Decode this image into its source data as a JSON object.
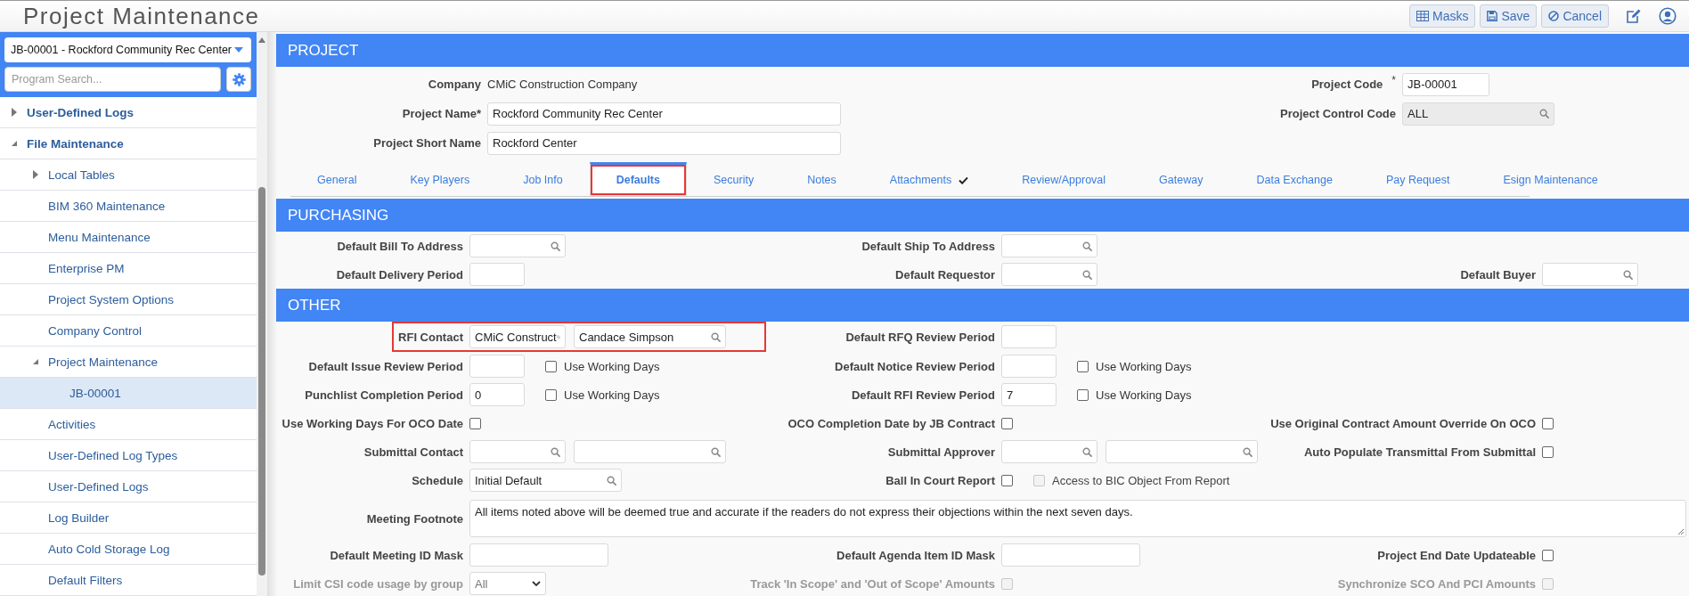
{
  "header": {
    "title": "Project Maintenance",
    "buttons": [
      {
        "kind": "masks",
        "label": "Masks"
      },
      {
        "kind": "save",
        "label": "Save"
      },
      {
        "kind": "cancel",
        "label": "Cancel"
      }
    ]
  },
  "sidebar": {
    "project_select": "JB-00001 - Rockford Community Rec Center",
    "search": {
      "placeholder": "Program Search..."
    },
    "items": [
      {
        "label": "User-Defined Logs",
        "expanded": false,
        "selected": false
      },
      {
        "label": "File Maintenance",
        "expanded": true,
        "selected": false,
        "children": [
          {
            "label": "Local Tables",
            "expanded": false,
            "selected": false
          },
          {
            "label": "BIM 360 Maintenance",
            "selected": false
          },
          {
            "label": "Menu Maintenance",
            "selected": false
          },
          {
            "label": "Enterprise PM",
            "selected": false
          },
          {
            "label": "Project System Options",
            "selected": false
          },
          {
            "label": "Company Control",
            "selected": false
          },
          {
            "label": "Project Maintenance",
            "expanded": true,
            "selected": false,
            "children": [
              {
                "label": "JB-00001",
                "selected": true
              }
            ]
          },
          {
            "label": "Activities",
            "selected": false
          },
          {
            "label": "User-Defined Log Types",
            "selected": false
          },
          {
            "label": "User-Defined Logs",
            "selected": false
          },
          {
            "label": "Log Builder",
            "selected": false
          },
          {
            "label": "Auto Cold Storage Log",
            "selected": false
          },
          {
            "label": "Default Filters",
            "selected": false
          }
        ]
      }
    ]
  },
  "project": {
    "title": "PROJECT",
    "rows": [
      {
        "left": {
          "label": "Company",
          "controls": [
            {
              "kind": "static",
              "value": "CMiC Construction Company"
            }
          ]
        },
        "right": {
          "label": "Project Code",
          "marker": "*",
          "controls": [
            {
              "kind": "code-text",
              "value": "JB-00001"
            }
          ]
        }
      },
      {
        "left": {
          "label": "Project Name*",
          "controls": [
            {
              "kind": "wide-text",
              "value": "Rockford Community Rec Center"
            }
          ]
        },
        "right": {
          "label": "Project Control Code",
          "controls": [
            {
              "kind": "wide-lookup",
              "value": "ALL",
              "disabled": true
            }
          ]
        }
      },
      {
        "left": {
          "label": "Project Short Name",
          "controls": [
            {
              "kind": "wide-text",
              "value": "Rockford Center"
            }
          ]
        }
      }
    ],
    "tabs": [
      {
        "label": "General",
        "selected": false
      },
      {
        "label": "Key Players",
        "selected": false
      },
      {
        "label": "Job Info",
        "selected": false
      },
      {
        "label": "Defaults",
        "selected": true,
        "highlighted": true
      },
      {
        "label": "Security",
        "selected": false
      },
      {
        "label": "Notes",
        "selected": false
      },
      {
        "label": "Attachments",
        "selected": false,
        "checked": true
      },
      {
        "label": "Review/Approval",
        "selected": false
      },
      {
        "label": "Gateway",
        "selected": false
      },
      {
        "label": "Data Exchange",
        "selected": false
      },
      {
        "label": "Pay Request",
        "selected": false
      },
      {
        "label": "Esign Maintenance",
        "selected": false
      }
    ]
  },
  "purchasing": {
    "title": "PURCHASING",
    "rows": [
      {
        "left": {
          "label": "Default Bill To Address",
          "controls": [
            {
              "kind": "lookup"
            }
          ]
        },
        "middle": {
          "label": "Default Ship To Address",
          "controls": [
            {
              "kind": "lookup"
            }
          ]
        }
      },
      {
        "left": {
          "label": "Default Delivery Period",
          "controls": [
            {
              "kind": "short-text"
            }
          ]
        },
        "middle": {
          "label": "Default Requestor",
          "controls": [
            {
              "kind": "lookup"
            }
          ]
        },
        "right": {
          "label": "Default Buyer",
          "controls": [
            {
              "kind": "lookup"
            }
          ]
        }
      }
    ]
  },
  "other": {
    "title": "OTHER",
    "rows": [
      {
        "left": {
          "label": "RFI Contact",
          "highlighted": true,
          "controls": [
            {
              "kind": "lookup",
              "value": "CMiC Construct"
            },
            {
              "kind": "wide-lookup",
              "value": "Candace Simpson"
            }
          ]
        },
        "middle": {
          "label": "Default RFQ Review Period",
          "controls": [
            {
              "kind": "short-text"
            }
          ]
        }
      },
      {
        "left": {
          "label": "Default Issue Review Period",
          "controls": [
            {
              "kind": "short-text"
            },
            {
              "kind": "checkbox",
              "label": "Use Working Days",
              "checked": false
            }
          ]
        },
        "middle": {
          "label": "Default Notice Review Period",
          "controls": [
            {
              "kind": "short-text"
            },
            {
              "kind": "checkbox",
              "label": "Use Working Days",
              "checked": false
            }
          ]
        }
      },
      {
        "left": {
          "label": "Punchlist Completion Period",
          "controls": [
            {
              "kind": "short-text",
              "value": "0"
            },
            {
              "kind": "checkbox",
              "label": "Use Working Days",
              "checked": false
            }
          ]
        },
        "middle": {
          "label": "Default RFI Review Period",
          "controls": [
            {
              "kind": "short-text",
              "value": "7"
            },
            {
              "kind": "checkbox",
              "label": "Use Working Days",
              "checked": false
            }
          ]
        }
      },
      {
        "left": {
          "label": "Use Working Days For OCO Date",
          "controls": [
            {
              "kind": "checkbox",
              "checked": false
            }
          ]
        },
        "middle": {
          "label": "OCO Completion Date by JB Contract",
          "controls": [
            {
              "kind": "checkbox",
              "checked": false
            }
          ]
        },
        "right": {
          "label": "Use Original Contract Amount Override On OCO",
          "controls": [
            {
              "kind": "checkbox",
              "checked": false
            }
          ]
        }
      },
      {
        "left": {
          "label": "Submittal Contact",
          "controls": [
            {
              "kind": "lookup"
            },
            {
              "kind": "wide-lookup"
            }
          ]
        },
        "middle": {
          "label": "Submittal Approver",
          "controls": [
            {
              "kind": "lookup"
            },
            {
              "kind": "wide-lookup"
            }
          ]
        },
        "right": {
          "label": "Auto Populate Transmittal From Submittal",
          "controls": [
            {
              "kind": "checkbox",
              "checked": false
            }
          ]
        }
      },
      {
        "left": {
          "label": "Schedule",
          "controls": [
            {
              "kind": "wide-lookup",
              "value": "Initial Default"
            }
          ]
        },
        "middle": {
          "label": "Ball In Court Report",
          "controls": [
            {
              "kind": "checkbox",
              "checked": false
            },
            {
              "kind": "checkbox",
              "label": "Access to BIC Object From Report",
              "checked": false,
              "disabled": true
            }
          ]
        }
      },
      {
        "left": {
          "label": "Meeting Footnote",
          "controls": [
            {
              "kind": "textarea",
              "value": "All items noted above will be deemed true and accurate if the readers do not express their objections within the next seven days."
            }
          ]
        }
      },
      {
        "left": {
          "label": "Default Meeting ID Mask",
          "controls": [
            {
              "kind": "text"
            }
          ]
        },
        "middle": {
          "label": "Default Agenda Item ID Mask",
          "controls": [
            {
              "kind": "text"
            }
          ]
        },
        "right": {
          "label": "Project End Date Updateable",
          "controls": [
            {
              "kind": "checkbox",
              "checked": false
            }
          ]
        }
      },
      {
        "left": {
          "label": "Limit CSI code usage by group",
          "disabled": true,
          "controls": [
            {
              "kind": "select",
              "value": "All"
            }
          ]
        },
        "middle": {
          "label": "Track 'In Scope' and 'Out of Scope' Amounts",
          "disabled": true,
          "controls": [
            {
              "kind": "checkbox",
              "checked": false
            }
          ]
        },
        "right": {
          "label": "Synchronize SCO And PCI Amounts",
          "disabled": true,
          "controls": [
            {
              "kind": "checkbox",
              "checked": false
            }
          ]
        }
      }
    ]
  }
}
